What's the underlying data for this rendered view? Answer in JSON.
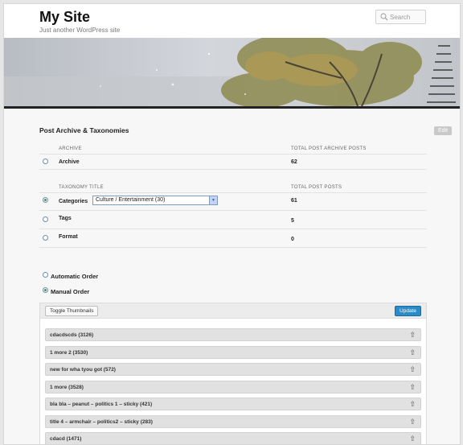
{
  "site": {
    "title": "My Site",
    "description": "Just another WordPress site"
  },
  "search": {
    "placeholder": "Search"
  },
  "section": {
    "title": "Post Archive & Taxonomies",
    "edit_label": "Edit"
  },
  "archive_table": {
    "col1": "ARCHIVE",
    "col2": "TOTAL POST ARCHIVE POSTS",
    "rows": [
      {
        "label": "Archive",
        "value": "62",
        "checked": false
      }
    ]
  },
  "taxonomy_table": {
    "col1": "TAXONOMY TITLE",
    "col2": "TOTAL POST POSTS",
    "rows": [
      {
        "label": "Categories",
        "value": "61",
        "checked": true
      },
      {
        "label": "Tags",
        "value": "5",
        "checked": false
      },
      {
        "label": "Format",
        "value": "0",
        "checked": false
      }
    ],
    "select_value": "Culture / Entertainment  (30)"
  },
  "order": {
    "automatic_label": "Automatic Order",
    "manual_label": "Manual Order",
    "selected": "manual"
  },
  "sort_panel": {
    "toggle_label": "Toggle Thumbnails",
    "update_label": "Update",
    "items": [
      "cdacdscds (3126)",
      "1 more 2 (3530)",
      "new for wha tyou got (572)",
      "1 more (3528)",
      "bla bla – peanut – politics 1 – sticky (421)",
      "title 4 – armchair – politics2 – sticky (283)",
      "cdacd (1471)"
    ]
  },
  "icons": {
    "search": "search-icon",
    "sort_handle": "up-arrow-icon",
    "select_arrow": "chevron-down-icon"
  },
  "colors": {
    "update_button": "#2a8bc7",
    "radio_checked": "#4a8f3a",
    "header_bar": "#222222"
  }
}
